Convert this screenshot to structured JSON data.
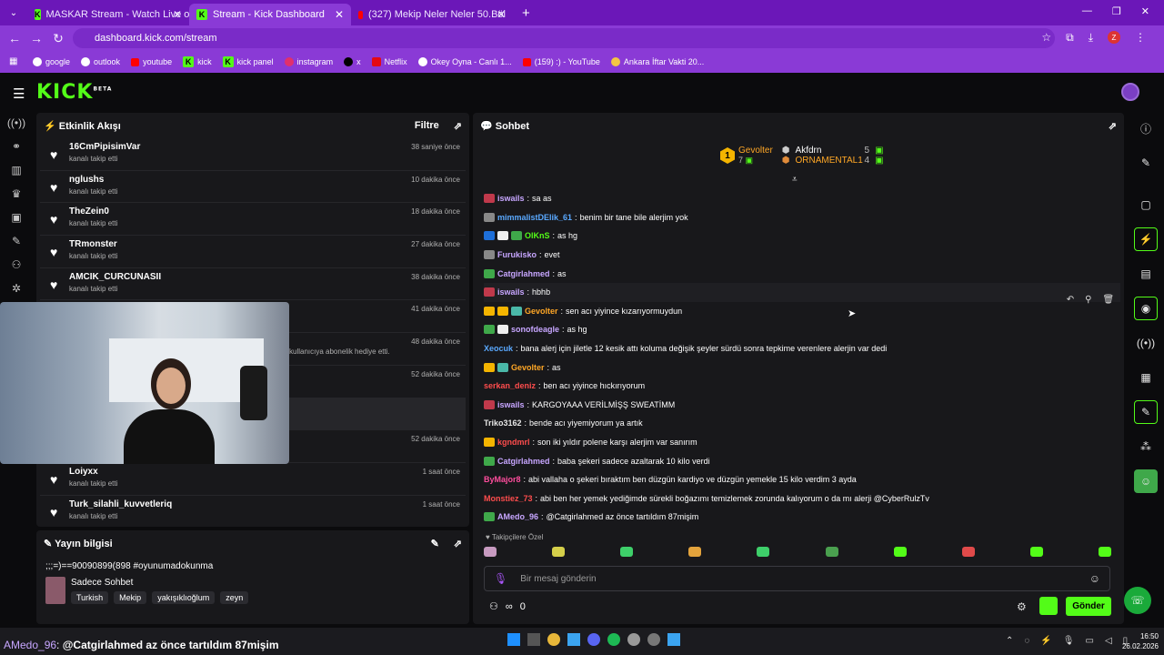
{
  "tabs": [
    {
      "title": "MASKAR Stream - Watch Live o",
      "icon": "kick"
    },
    {
      "title": "Stream - Kick Dashboard",
      "icon": "kick"
    },
    {
      "title": "(327) Mekip Neler Neler 50.Böl",
      "icon": "youtube"
    }
  ],
  "url": "dashboard.kick.com/stream",
  "bookmarks": [
    "google",
    "outlook",
    "youtube",
    "kick",
    "kick panel",
    "instagram",
    "x",
    "Netflix",
    "Okey Oyna - Canlı 1...",
    "(159) :) - YouTube",
    "Ankara İftar Vakti 20..."
  ],
  "logo": "KICK",
  "logo_tag": "BETA",
  "activity": {
    "title": "Etkinlik Akışı",
    "filter": "Filtre",
    "events": [
      {
        "name": "16CmPipisimVar",
        "sub": "kanalı takip etti",
        "time": "38 saniye önce"
      },
      {
        "name": "nglushs",
        "sub": "kanalı takip etti",
        "time": "10 dakika önce"
      },
      {
        "name": "TheZein0",
        "sub": "kanalı takip etti",
        "time": "18 dakika önce"
      },
      {
        "name": "TRmonster",
        "sub": "kanalı takip etti",
        "time": "27 dakika önce"
      },
      {
        "name": "AMCIK_CURCUNASII",
        "sub": "kanalı takip etti",
        "time": "38 dakika önce"
      },
      {
        "name": "",
        "sub": "",
        "time": "41 dakika önce"
      },
      {
        "name": "",
        "sub": "kullanıcıya abonelik hediye etti.",
        "time": "48 dakika önce"
      },
      {
        "name": "",
        "sub": "",
        "time": "52 dakika önce"
      },
      {
        "name": "",
        "sub": "",
        "time": "52 dakika önce"
      },
      {
        "name": "Loiyxx",
        "sub": "kanalı takip etti",
        "time": "1 saat önce"
      },
      {
        "name": "Turk_silahli_kuvvetleriq",
        "sub": "kanalı takip etti",
        "time": "1 saat önce"
      }
    ]
  },
  "stream_info": {
    "title": "Yayın bilgisi",
    "stream_title": ";;;=)==90090899(898 #oyunumadokunma",
    "category": "Sadece Sohbet",
    "tags": [
      "Turkish",
      "Mekip",
      "yakışıklıoğlum",
      "zeyn"
    ]
  },
  "chat": {
    "title": "Sohbet",
    "leaderboard": [
      {
        "name": "Gevolter",
        "count": "7",
        "rank": "1"
      },
      {
        "name": "Akfdrn",
        "count": "5"
      },
      {
        "name": "ORNAMENTAL1",
        "count": "4"
      }
    ],
    "messages": [
      {
        "user": "iswails",
        "color": "#c7a6ff",
        "text": "sa as"
      },
      {
        "user": "mimmalistDElik_61",
        "color": "#5aa9ff",
        "text": "benim bir tane bile alerjim yok"
      },
      {
        "user": "OlKnS",
        "color": "#53fc18",
        "text": "as hg"
      },
      {
        "user": "Furukisko",
        "color": "#c7a6ff",
        "text": "evet"
      },
      {
        "user": "Catgirlahmed",
        "color": "#c7a6ff",
        "text": "as"
      },
      {
        "user": "iswails",
        "color": "#c7a6ff",
        "text": "hbhb"
      },
      {
        "user": "Gevolter",
        "color": "#ffa726",
        "text": "sen acı yiyince kızarıyormuydun"
      },
      {
        "user": "sonofdeagle",
        "color": "#c7a6ff",
        "text": "as hg"
      },
      {
        "user": "Xeocuk",
        "color": "#5aa9ff",
        "text": "bana alerj için jiletle 12 kesik attı koluma değişik şeyler sürdü sonra tepkime verenlere alerjin var dedi"
      },
      {
        "user": "Gevolter",
        "color": "#ffa726",
        "text": "as"
      },
      {
        "user": "serkan_deniz",
        "color": "#ff4d4d",
        "text": "ben acı yiyince hıckırıyorum"
      },
      {
        "user": "iswails",
        "color": "#c7a6ff",
        "text": "KARGOYAAA VERİLMİŞŞ SWEATİMM"
      },
      {
        "user": "Triko3162",
        "color": "#e6e6e6",
        "text": "bende acı yiyemiyorum ya artık"
      },
      {
        "user": "kgndmrl",
        "color": "#ff4d4d",
        "text": "son iki yıldır polene karşı alerjim var sanırım"
      },
      {
        "user": "Catgirlahmed",
        "color": "#c7a6ff",
        "text": "baba şekeri sadece azaltarak 10 kilo verdi"
      },
      {
        "user": "ByMajor8",
        "color": "#ff4d9d",
        "text": "abi vallaha o şekeri bıraktım ben düzgün kardiyo ve düzgün yemekle 15 kilo verdim 3 ayda"
      },
      {
        "user": "Monstiez_73",
        "color": "#ff4d4d",
        "text": "abi ben her yemek yediğimde sürekli boğazımı temizlemek zorunda kalıyorum o da mı alerji @CyberRulzTv"
      },
      {
        "user": "AMedo_96",
        "color": "#c7a6ff",
        "text": "@Catgirlahmed az önce tartıldım 87mişim"
      }
    ],
    "followers_only": "Takipçilere Özel",
    "input_placeholder": "Bir mesaj gönderin",
    "viewer_count": "0",
    "send": "Gönder"
  },
  "overlay": {
    "user": "AMedo_96",
    "text": "@Catgirlahmed az önce tartıldım 87mişim"
  },
  "clock": {
    "time": "16:50",
    "date": "26.02.2026"
  }
}
